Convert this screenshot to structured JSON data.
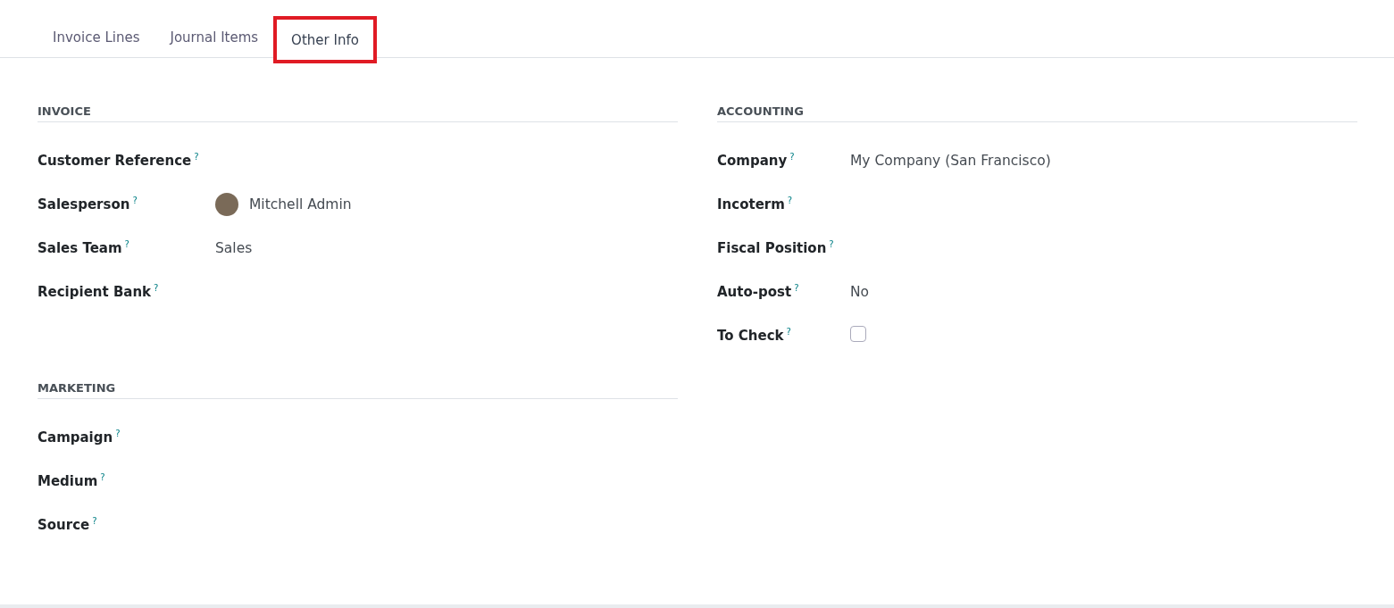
{
  "tabs": [
    {
      "label": "Invoice Lines",
      "selected": false,
      "highlighted": false
    },
    {
      "label": "Journal Items",
      "selected": false,
      "highlighted": false
    },
    {
      "label": "Other Info",
      "selected": true,
      "highlighted": true
    }
  ],
  "columns": [
    {
      "sections": [
        {
          "title": "INVOICE",
          "fields": [
            {
              "kind": "text",
              "label": "Customer Reference",
              "help": "?"
            },
            {
              "kind": "avatar",
              "label": "Salesperson",
              "help": "?",
              "value": "Mitchell Admin"
            },
            {
              "kind": "text",
              "label": "Sales Team",
              "help": "?",
              "value": "Sales"
            },
            {
              "kind": "text",
              "label": "Recipient Bank",
              "help": "?"
            }
          ]
        },
        {
          "title": "MARKETING",
          "fields": [
            {
              "kind": "text",
              "label": "Campaign",
              "help": "?"
            },
            {
              "kind": "text",
              "label": "Medium",
              "help": "?"
            },
            {
              "kind": "text",
              "label": "Source",
              "help": "?"
            }
          ]
        }
      ]
    },
    {
      "sections": [
        {
          "title": "ACCOUNTING",
          "fields": [
            {
              "kind": "text",
              "label": "Company",
              "help": "?",
              "value": "My Company (San Francisco)"
            },
            {
              "kind": "text",
              "label": "Incoterm",
              "help": "?"
            },
            {
              "kind": "text",
              "label": "Fiscal Position",
              "help": "?"
            },
            {
              "kind": "text",
              "label": "Auto-post",
              "help": "?",
              "value": "No"
            },
            {
              "kind": "checkbox",
              "label": "To Check",
              "help": "?",
              "checked": false
            }
          ]
        }
      ]
    }
  ]
}
